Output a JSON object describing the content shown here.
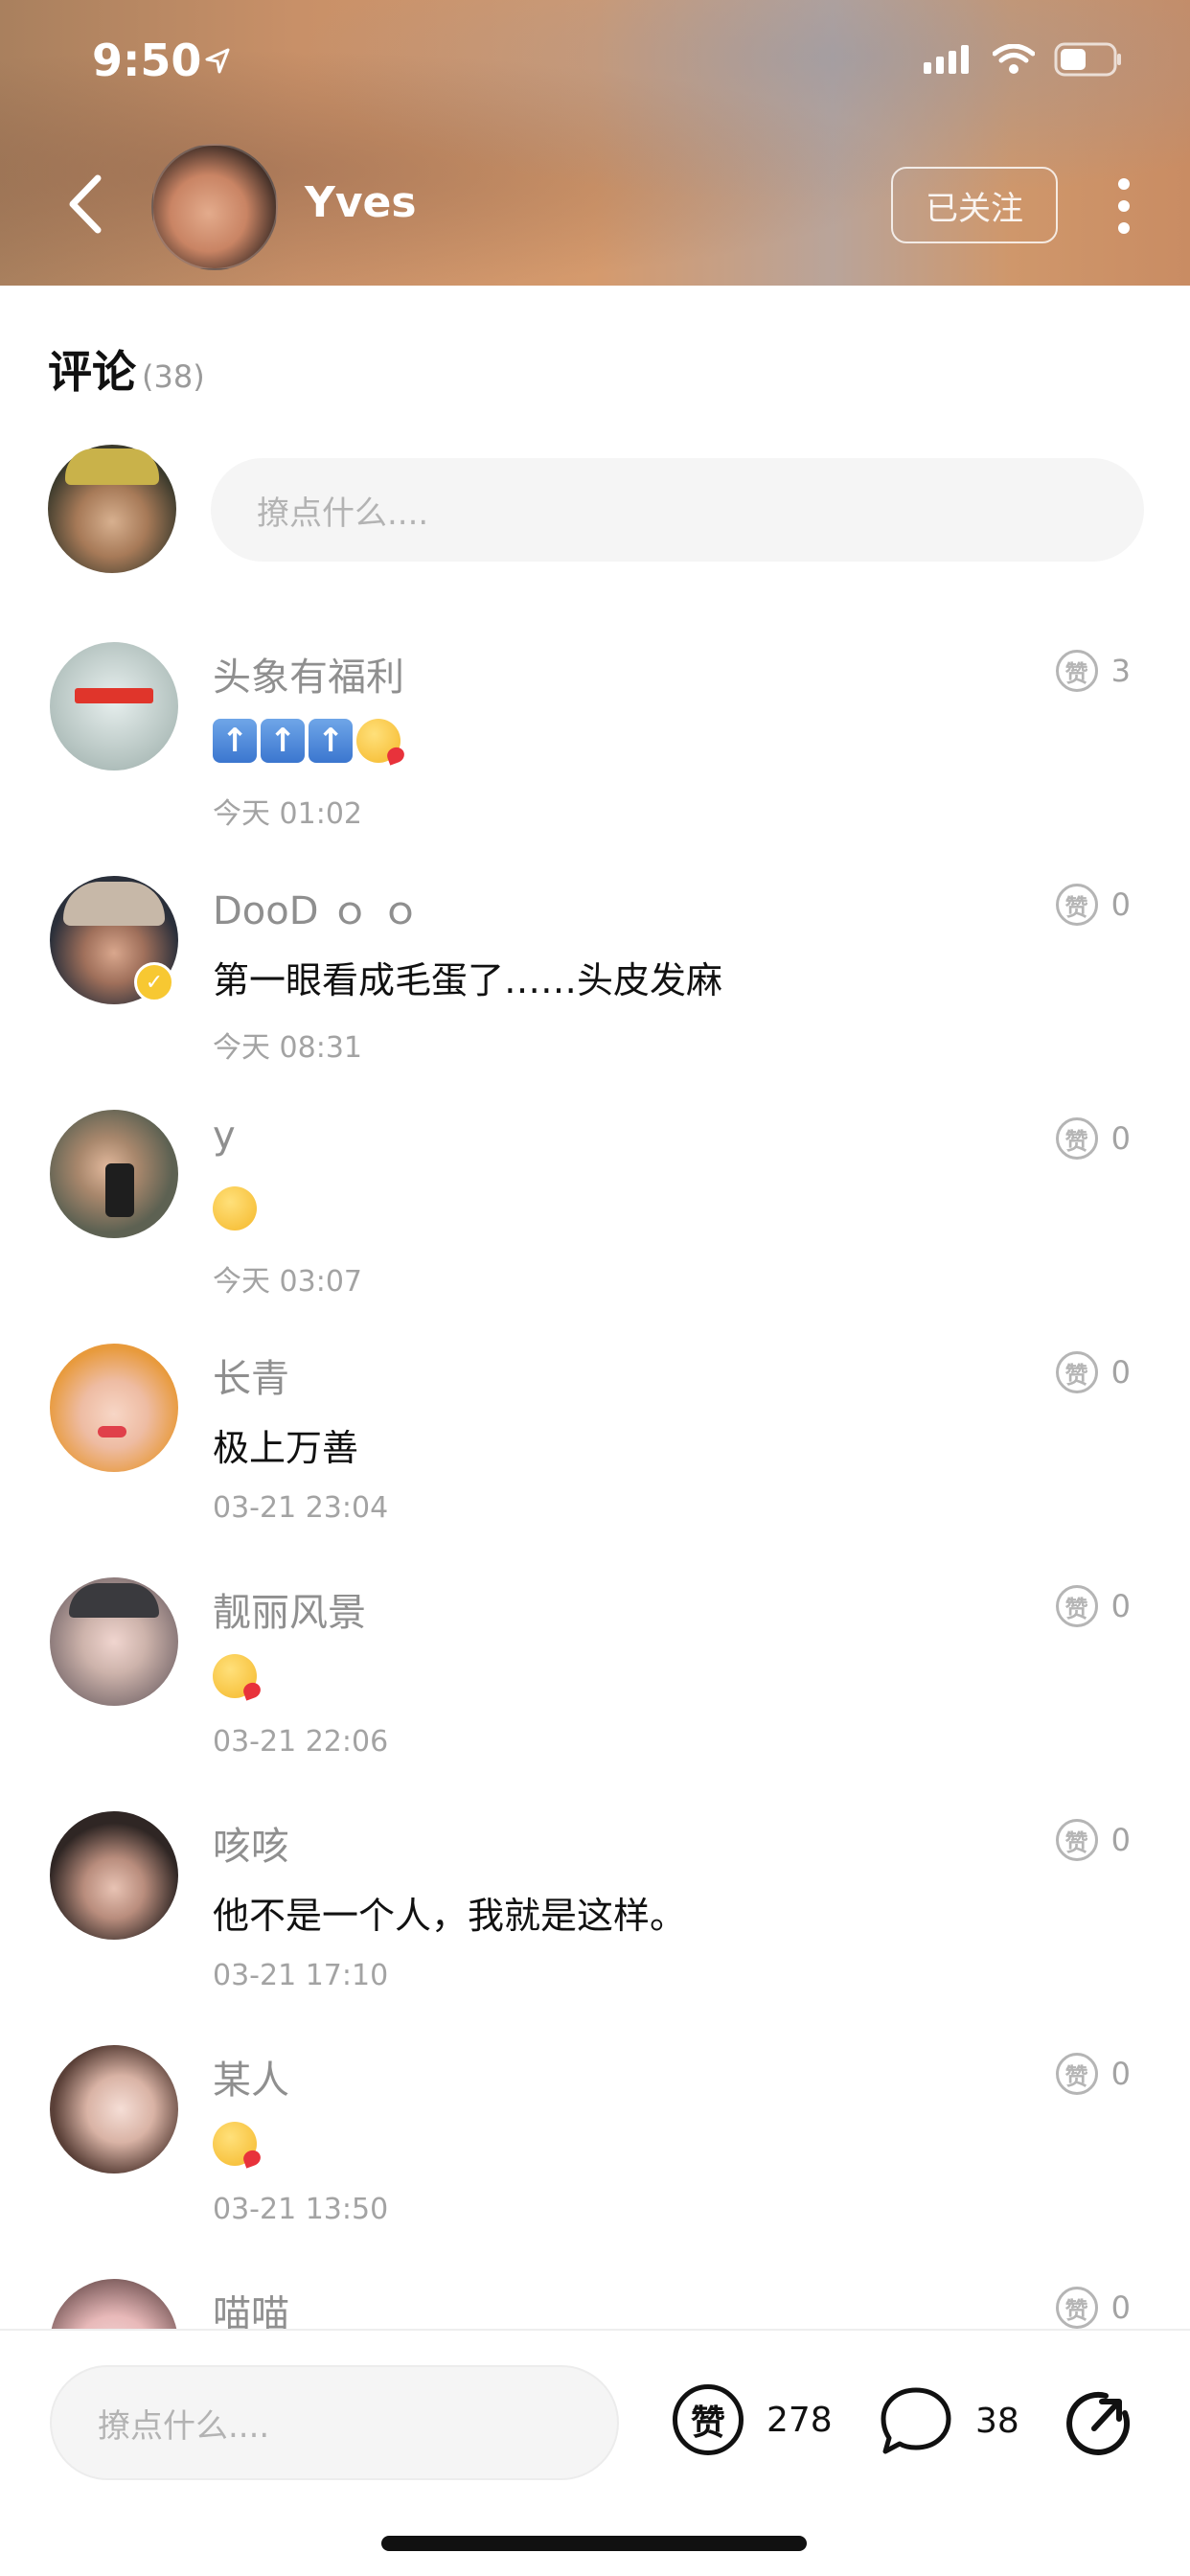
{
  "status_bar": {
    "time": "9:50"
  },
  "header": {
    "user_name": "Yves",
    "follow_label": "已关注"
  },
  "comments_section": {
    "title": "评论",
    "count": "(38)",
    "input_placeholder": "撩点什么...."
  },
  "comments": [
    {
      "name": "头象有福利",
      "text_type": "emoji",
      "text": "",
      "time": "今天 01:02",
      "likes": "3",
      "like_label": "赞",
      "avatar_color": "#b9c7c4"
    },
    {
      "name": "DooD ｏ ｏ",
      "text_type": "text",
      "text": "第一眼看成毛蛋了……头皮发麻",
      "time": "今天 08:31",
      "likes": "0",
      "like_label": "赞",
      "avatar_color": "#3a3f4a"
    },
    {
      "name": "y",
      "text_type": "emoji",
      "text": "",
      "time": "今天 03:07",
      "likes": "0",
      "like_label": "赞",
      "avatar_color": "#6b6e5c"
    },
    {
      "name": "长青",
      "text_type": "text",
      "text": "极上万善",
      "time": "03-21 23:04",
      "likes": "0",
      "like_label": "赞",
      "avatar_color": "#e6a24c"
    },
    {
      "name": "靓丽风景",
      "text_type": "emoji",
      "text": "",
      "time": "03-21 22:06",
      "likes": "0",
      "like_label": "赞",
      "avatar_color": "#b9a9a9"
    },
    {
      "name": "咳咳",
      "text_type": "text",
      "text": "他不是一个人，我就是这样。",
      "time": "03-21 17:10",
      "likes": "0",
      "like_label": "赞",
      "avatar_color": "#3d2f2c"
    },
    {
      "name": "某人",
      "text_type": "emoji",
      "text": "",
      "time": "03-21 13:50",
      "likes": "0",
      "like_label": "赞",
      "avatar_color": "#8d6e63"
    },
    {
      "name": "喵喵",
      "text_type": "text",
      "text": "",
      "time": "",
      "likes": "0",
      "like_label": "赞",
      "avatar_color": "#f3d6d6"
    }
  ],
  "bottom_bar": {
    "input_placeholder": "撩点什么....",
    "like_label": "赞",
    "like_count": "278",
    "comment_count": "38"
  }
}
